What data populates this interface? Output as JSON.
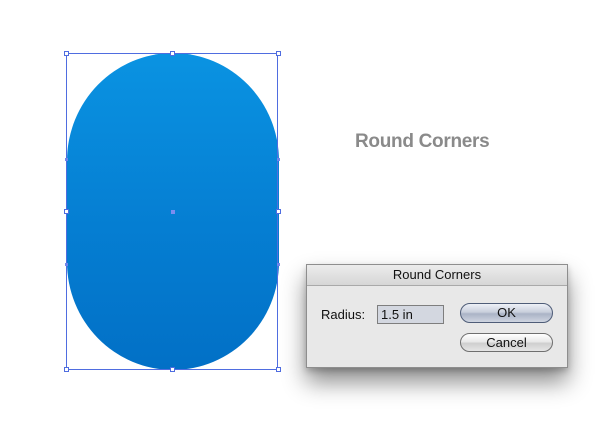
{
  "artboard": {
    "shape_gradient": [
      "#0a93e2",
      "#0270c6"
    ],
    "selection_color": "#4f6de0"
  },
  "title": "Round Corners",
  "dialog": {
    "title": "Round Corners",
    "radius_label": "Radius:",
    "radius_value": "1.5 in",
    "ok_label": "OK",
    "cancel_label": "Cancel"
  }
}
